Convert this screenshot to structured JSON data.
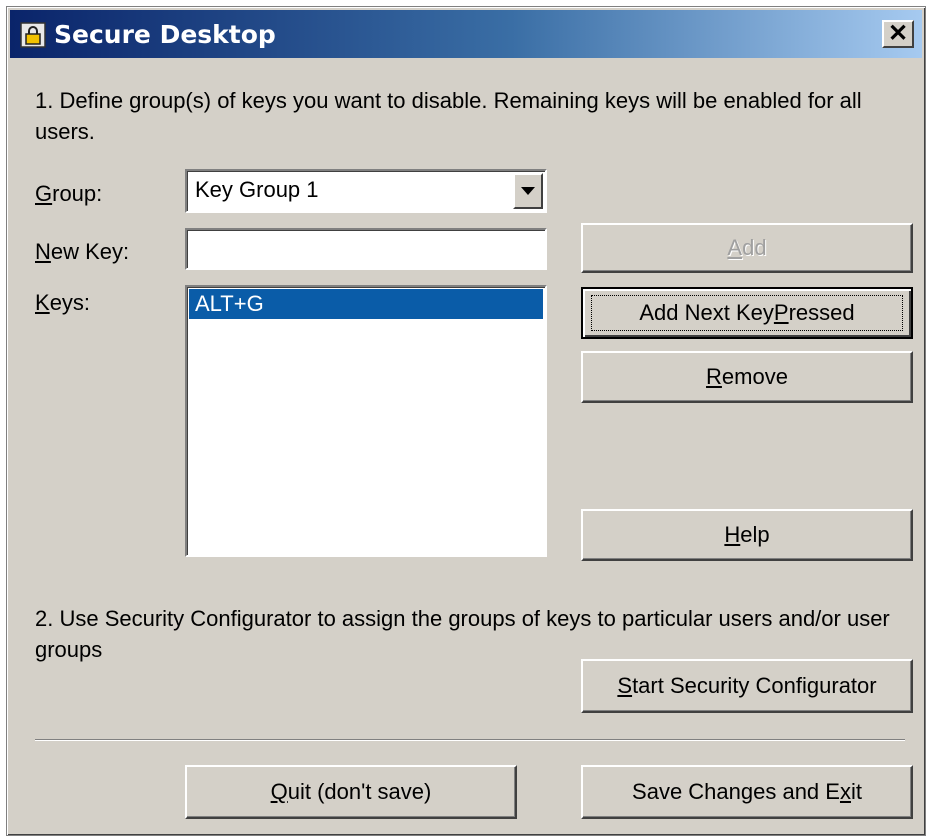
{
  "window": {
    "title": "Secure Desktop",
    "close_label": "✕"
  },
  "step1": {
    "text": "1. Define group(s) of keys you want to disable. Remaining keys will be enabled for all users."
  },
  "group": {
    "label_first": "G",
    "label_rest": "roup:",
    "value": "Key Group 1"
  },
  "new_key": {
    "label_first": "N",
    "label_rest": "ew Key:",
    "value": ""
  },
  "keys": {
    "label_first": "K",
    "label_rest": "eys:",
    "items": [
      "ALT+G"
    ]
  },
  "buttons": {
    "add": {
      "first": "A",
      "rest": "dd"
    },
    "add_next": {
      "pre": "Add Next Key ",
      "first": "P",
      "rest": "ressed"
    },
    "remove": {
      "first": "R",
      "rest": "emove"
    },
    "help": {
      "first": "H",
      "rest": "elp"
    },
    "start": {
      "first": "S",
      "rest": "tart Security Configurator"
    },
    "quit": {
      "first": "Q",
      "rest": "uit (don't save)"
    },
    "save": {
      "pre": "Save Changes and E",
      "first": "x",
      "rest": "it"
    }
  },
  "step2": {
    "text": "2. Use Security Configurator to assign the groups of keys to particular users and/or user groups"
  },
  "colors": {
    "title_start": "#0a246a",
    "title_end": "#a6caf0",
    "selection": "#0a5ca8",
    "face": "#d4d0c8"
  }
}
